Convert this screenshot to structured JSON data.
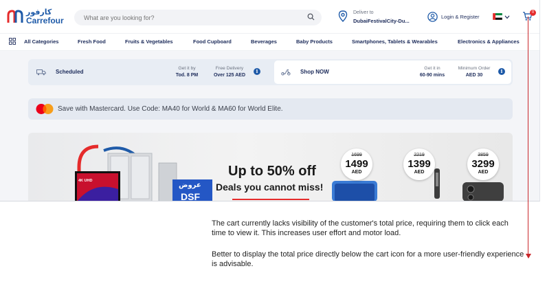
{
  "header": {
    "logo_ar": "كارفور",
    "logo_en": "Carrefour",
    "search_placeholder": "What are you looking for?",
    "deliver_label": "Deliver to",
    "deliver_value": "DubaiFestivalCity-Du...",
    "login_label": "Login & Register",
    "cart_count": "0"
  },
  "nav": {
    "items": [
      "All Categories",
      "Fresh Food",
      "Fruits & Vegetables",
      "Food Cupboard",
      "Beverages",
      "Baby Products",
      "Smartphones, Tablets & Wearables",
      "Electronics & Appliances"
    ]
  },
  "delivery": {
    "scheduled": {
      "title": "Scheduled",
      "k1": "Get it by",
      "v1": "Tod. 8 PM",
      "k2": "Free Delivery",
      "v2": "Over 125 AED"
    },
    "now": {
      "title": "Shop NOW",
      "k1": "Get it in",
      "v1": "60-90 mins",
      "k2": "Minimum Order",
      "v2": "AED 30"
    }
  },
  "promo": {
    "text": "Save with Mastercard. Use Code: MA40 for World & MA60 for World Elite."
  },
  "banner": {
    "headline": "Up to 50% off",
    "subline": "Deals you cannot miss!",
    "tv_label": "4K UHD",
    "offers_ar": "عروض",
    "dsf": "DSF",
    "prices": [
      {
        "old": "1699",
        "new": "1499",
        "currency": "AED"
      },
      {
        "old": "2219",
        "new": "1399",
        "currency": "AED"
      },
      {
        "old": "3859",
        "new": "3299",
        "currency": "AED"
      }
    ]
  },
  "annotation": {
    "paragraph1": "The cart currently lacks visibility of the customer's total price, requiring them to click each time to view it. This increases user effort and motor load.",
    "paragraph2": "Better to display the total price directly below the cart icon for a more user-friendly experience is advisable."
  },
  "colors": {
    "brand_blue": "#1e5aa8",
    "brand_red": "#e52b2b",
    "annotation_red": "#c9262a"
  }
}
